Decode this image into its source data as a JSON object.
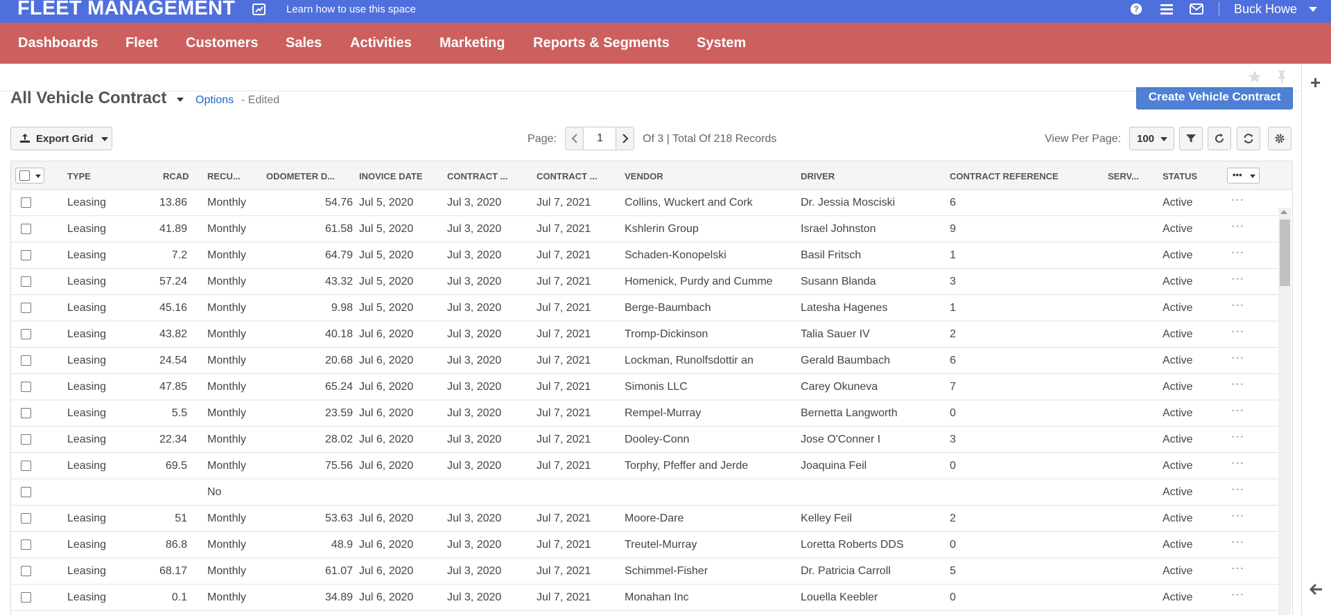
{
  "app": {
    "title": "FLEET MANAGEMENT",
    "help_link": "Learn how to use this space",
    "user": "Buck Howe",
    "accent_top": "#4f6fdc",
    "accent_nav": "#cd5f5f"
  },
  "nav": {
    "items": [
      "Dashboards",
      "Fleet",
      "Customers",
      "Sales",
      "Activities",
      "Marketing",
      "Reports & Segments",
      "System"
    ]
  },
  "view": {
    "title": "All Vehicle Contract",
    "options": "Options",
    "edited": "- Edited",
    "create_button": "Create Vehicle Contract"
  },
  "toolbar": {
    "export": "Export Grid",
    "page_label": "Page:",
    "page": "1",
    "page_total": "Of 3 |  Total Of 218 Records",
    "view_per_page_label": "View Per Page:",
    "view_per_page": "100"
  },
  "grid": {
    "columns": [
      "TYPE",
      "RCAD",
      "RECU...",
      "ODOMETER D...",
      "INOVICE DATE",
      "CONTRACT ...",
      "CONTRACT ...",
      "VENDOR",
      "DRIVER",
      "CONTRACT REFERENCE",
      "SERV...",
      "STATUS"
    ],
    "more_label": "•••",
    "row_action": "···",
    "rows": [
      {
        "type": "Leasing",
        "rcad": "13.86",
        "recu": "Monthly",
        "odo": "54.76",
        "inv": "Jul 5, 2020",
        "c1": "Jul 3, 2020",
        "c2": "Jul 7, 2021",
        "vendor": "Collins, Wuckert and Cork",
        "driver": "Dr. Jessia Mosciski",
        "ref": "6",
        "serv": "",
        "status": "Active"
      },
      {
        "type": "Leasing",
        "rcad": "41.89",
        "recu": "Monthly",
        "odo": "61.58",
        "inv": "Jul 5, 2020",
        "c1": "Jul 3, 2020",
        "c2": "Jul 7, 2021",
        "vendor": "Kshlerin Group",
        "driver": "Israel Johnston",
        "ref": "9",
        "serv": "",
        "status": "Active"
      },
      {
        "type": "Leasing",
        "rcad": "7.2",
        "recu": "Monthly",
        "odo": "64.79",
        "inv": "Jul 5, 2020",
        "c1": "Jul 3, 2020",
        "c2": "Jul 7, 2021",
        "vendor": "Schaden-Konopelski",
        "driver": "Basil Fritsch",
        "ref": "1",
        "serv": "",
        "status": "Active"
      },
      {
        "type": "Leasing",
        "rcad": "57.24",
        "recu": "Monthly",
        "odo": "43.32",
        "inv": "Jul 5, 2020",
        "c1": "Jul 3, 2020",
        "c2": "Jul 7, 2021",
        "vendor": "Homenick, Purdy and Cumme",
        "driver": "Susann Blanda",
        "ref": "3",
        "serv": "",
        "status": "Active"
      },
      {
        "type": "Leasing",
        "rcad": "45.16",
        "recu": "Monthly",
        "odo": "9.98",
        "inv": "Jul 5, 2020",
        "c1": "Jul 3, 2020",
        "c2": "Jul 7, 2021",
        "vendor": "Berge-Baumbach",
        "driver": "Latesha Hagenes",
        "ref": "1",
        "serv": "",
        "status": "Active"
      },
      {
        "type": "Leasing",
        "rcad": "43.82",
        "recu": "Monthly",
        "odo": "40.18",
        "inv": "Jul 6, 2020",
        "c1": "Jul 3, 2020",
        "c2": "Jul 7, 2021",
        "vendor": "Tromp-Dickinson",
        "driver": "Talia Sauer IV",
        "ref": "2",
        "serv": "",
        "status": "Active"
      },
      {
        "type": "Leasing",
        "rcad": "24.54",
        "recu": "Monthly",
        "odo": "20.68",
        "inv": "Jul 6, 2020",
        "c1": "Jul 3, 2020",
        "c2": "Jul 7, 2021",
        "vendor": "Lockman, Runolfsdottir an",
        "driver": "Gerald Baumbach",
        "ref": "6",
        "serv": "",
        "status": "Active"
      },
      {
        "type": "Leasing",
        "rcad": "47.85",
        "recu": "Monthly",
        "odo": "65.24",
        "inv": "Jul 6, 2020",
        "c1": "Jul 3, 2020",
        "c2": "Jul 7, 2021",
        "vendor": "Simonis LLC",
        "driver": "Carey Okuneva",
        "ref": "7",
        "serv": "",
        "status": "Active"
      },
      {
        "type": "Leasing",
        "rcad": "5.5",
        "recu": "Monthly",
        "odo": "23.59",
        "inv": "Jul 6, 2020",
        "c1": "Jul 3, 2020",
        "c2": "Jul 7, 2021",
        "vendor": "Rempel-Murray",
        "driver": "Bernetta Langworth",
        "ref": "0",
        "serv": "",
        "status": "Active"
      },
      {
        "type": "Leasing",
        "rcad": "22.34",
        "recu": "Monthly",
        "odo": "28.02",
        "inv": "Jul 6, 2020",
        "c1": "Jul 3, 2020",
        "c2": "Jul 7, 2021",
        "vendor": "Dooley-Conn",
        "driver": "Jose O'Conner I",
        "ref": "3",
        "serv": "",
        "status": "Active"
      },
      {
        "type": "Leasing",
        "rcad": "69.5",
        "recu": "Monthly",
        "odo": "75.56",
        "inv": "Jul 6, 2020",
        "c1": "Jul 3, 2020",
        "c2": "Jul 7, 2021",
        "vendor": "Torphy, Pfeffer and Jerde",
        "driver": "Joaquina Feil",
        "ref": "0",
        "serv": "",
        "status": "Active"
      },
      {
        "type": "",
        "rcad": "",
        "recu": "No",
        "odo": "",
        "inv": "",
        "c1": "",
        "c2": "",
        "vendor": "",
        "driver": "",
        "ref": "",
        "serv": "",
        "status": "Active"
      },
      {
        "type": "Leasing",
        "rcad": "51",
        "recu": "Monthly",
        "odo": "53.63",
        "inv": "Jul 6, 2020",
        "c1": "Jul 3, 2020",
        "c2": "Jul 7, 2021",
        "vendor": "Moore-Dare",
        "driver": "Kelley Feil",
        "ref": "2",
        "serv": "",
        "status": "Active"
      },
      {
        "type": "Leasing",
        "rcad": "86.8",
        "recu": "Monthly",
        "odo": "48.9",
        "inv": "Jul 6, 2020",
        "c1": "Jul 3, 2020",
        "c2": "Jul 7, 2021",
        "vendor": "Treutel-Murray",
        "driver": "Loretta Roberts DDS",
        "ref": "0",
        "serv": "",
        "status": "Active"
      },
      {
        "type": "Leasing",
        "rcad": "68.17",
        "recu": "Monthly",
        "odo": "61.07",
        "inv": "Jul 6, 2020",
        "c1": "Jul 3, 2020",
        "c2": "Jul 7, 2021",
        "vendor": "Schimmel-Fisher",
        "driver": "Dr. Patricia Carroll",
        "ref": "5",
        "serv": "",
        "status": "Active"
      },
      {
        "type": "Leasing",
        "rcad": "0.1",
        "recu": "Monthly",
        "odo": "34.89",
        "inv": "Jul 6, 2020",
        "c1": "Jul 3, 2020",
        "c2": "Jul 7, 2021",
        "vendor": "Monahan Inc",
        "driver": "Louella Keebler",
        "ref": "0",
        "serv": "",
        "status": "Active"
      }
    ]
  }
}
